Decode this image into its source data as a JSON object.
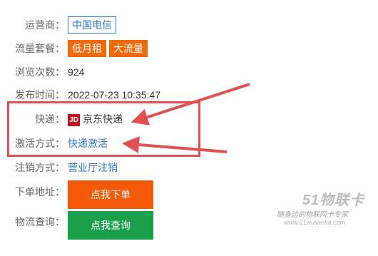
{
  "operator": {
    "label": "运营商：",
    "value": "中国电信"
  },
  "plan": {
    "label": "流量套餐：",
    "tags": [
      "低月租",
      "大流量"
    ]
  },
  "views": {
    "label": "浏览次数：",
    "value": "924"
  },
  "publish_time": {
    "label": "发布时间：",
    "value": "2022-07-23 10:35:47"
  },
  "express": {
    "label": "快递：",
    "icon": "JD",
    "value": "京东快递"
  },
  "activation": {
    "label": "激活方式：",
    "value": "快递激活"
  },
  "cancellation": {
    "label": "注销方式：",
    "value": "营业厅注销"
  },
  "order": {
    "label": "下单地址：",
    "button": "点我下单"
  },
  "logistics": {
    "label": "物流查询：",
    "button": "点我查询"
  },
  "watermark": {
    "logo": "51物联卡",
    "slogan": "随身边的物联网卡专家",
    "url": "www.51wulianka.com"
  },
  "colors": {
    "orange": "#f2680c",
    "green": "#1aa04b",
    "blue": "#2f78c4",
    "highlight": "#e05252"
  }
}
